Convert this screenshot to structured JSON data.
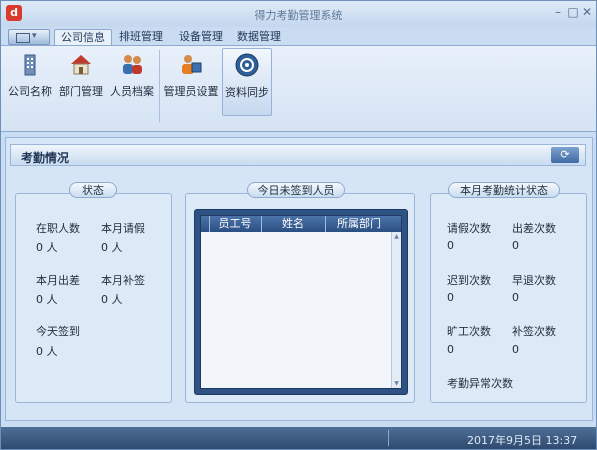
{
  "window": {
    "title": "得力考勤管理系统"
  },
  "tabs": [
    {
      "label": "公司信息",
      "active": true
    },
    {
      "label": "排班管理",
      "active": false
    },
    {
      "label": "设备管理",
      "active": false
    },
    {
      "label": "数据管理",
      "active": false
    }
  ],
  "ribbon": [
    {
      "label": "公司名称",
      "icon": "building-icon"
    },
    {
      "label": "部门管理",
      "icon": "house-icon"
    },
    {
      "label": "人员档案",
      "icon": "people-icon"
    },
    {
      "label": "管理员设置",
      "icon": "admin-icon"
    },
    {
      "label": "资料同步",
      "icon": "sync-icon",
      "active": true
    }
  ],
  "content": {
    "title": "考勤情况",
    "status_panel": {
      "title": "状态",
      "items": [
        {
          "label": "在职人数",
          "value": "0 人"
        },
        {
          "label": "本月请假",
          "value": "0 人"
        },
        {
          "label": "本月出差",
          "value": "0 人"
        },
        {
          "label": "本月补签",
          "value": "0 人"
        },
        {
          "label": "今天签到",
          "value": "0 人"
        }
      ]
    },
    "unsigned_panel": {
      "title": "今日未签到人员",
      "columns": [
        "员工号",
        "姓名",
        "所属部门"
      ]
    },
    "stats_panel": {
      "title": "本月考勤统计状态",
      "items": [
        {
          "label": "请假次数",
          "value": "0"
        },
        {
          "label": "出差次数",
          "value": "0"
        },
        {
          "label": "迟到次数",
          "value": "0"
        },
        {
          "label": "早退次数",
          "value": "0"
        },
        {
          "label": "旷工次数",
          "value": "0"
        },
        {
          "label": "补签次数",
          "value": "0"
        },
        {
          "label": "考勤异常次数",
          "value": ""
        }
      ]
    }
  },
  "statusbar": {
    "datetime": "2017年9月5日 13:37"
  },
  "colors": {
    "accent": "#2d5283",
    "background": "#c9dcf1"
  }
}
